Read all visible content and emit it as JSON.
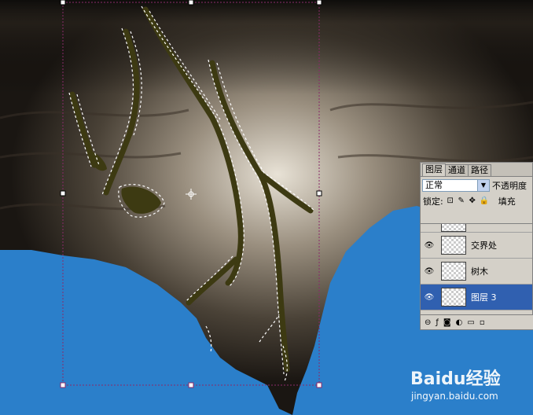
{
  "panel": {
    "tabs": [
      {
        "label": "图层"
      },
      {
        "label": "通道"
      },
      {
        "label": "路径"
      }
    ],
    "blend_mode": "正常",
    "opacity_label": "不透明度",
    "lock_label": "锁定:",
    "fill_label": "填充",
    "layers": [
      {
        "name": "交界处",
        "visible": true,
        "selected": false
      },
      {
        "name": "树木",
        "visible": true,
        "selected": false
      },
      {
        "name": "图层 3",
        "visible": true,
        "selected": true
      }
    ]
  },
  "watermark": {
    "logo": "Baidu经验",
    "url": "jingyan.baidu.com"
  },
  "colors": {
    "sky": "#2b7fca",
    "selection_panel": "#3060b0"
  }
}
